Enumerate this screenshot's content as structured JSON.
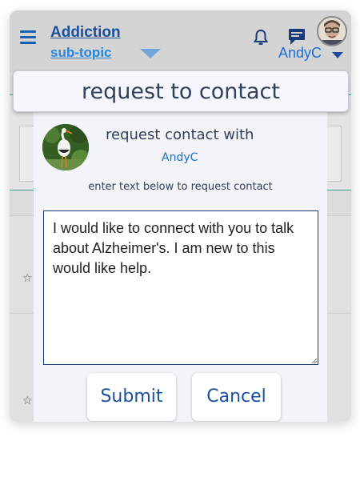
{
  "header": {
    "title": "Addiction",
    "subtitle": "sub-topic",
    "user_name": "AndyC"
  },
  "modal": {
    "title": "request to contact",
    "heading": "request contact with",
    "contact_name": "AndyC",
    "instruction": "enter text below to request contact",
    "message": "I would like to connect with you to talk about Alzheimer's. I am new to this would like help.",
    "submit_label": "Submit",
    "cancel_label": "Cancel"
  },
  "icons": {
    "menu": "hamburger-menu-icon",
    "notifications": "bell-icon",
    "messages": "chat-icon",
    "favorite": "star-icon"
  },
  "colors": {
    "brand_dark": "#1b4f9c",
    "brand_link": "#1b6fd0",
    "modal_bg": "#f2f4f8",
    "header_bg": "#d4d4d4"
  }
}
